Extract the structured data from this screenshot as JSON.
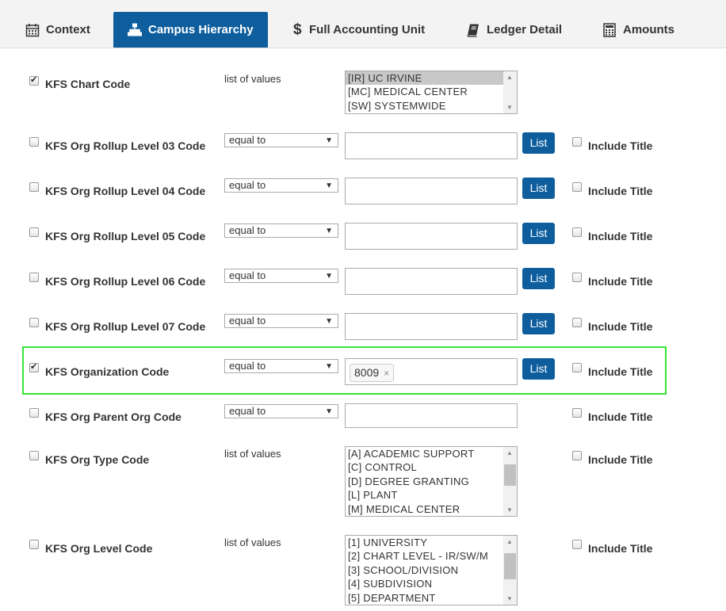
{
  "tabs": [
    {
      "label": "Context",
      "icon": "calendar-icon",
      "active": false
    },
    {
      "label": "Campus Hierarchy",
      "icon": "sitemap-icon",
      "active": true
    },
    {
      "label": "Full Accounting Unit",
      "icon": "dollar-icon",
      "active": false
    },
    {
      "label": "Ledger Detail",
      "icon": "book-icon",
      "active": false
    },
    {
      "label": "Amounts",
      "icon": "calculator-icon",
      "active": false
    }
  ],
  "colors": {
    "accent": "#0e5e9e",
    "highlight": "#33e533"
  },
  "list_button_label": "List",
  "include_title_label": "Include Title",
  "rows": {
    "chart": {
      "label": "KFS Chart Code",
      "checked": true,
      "operator": "list of values",
      "options": [
        "[IR] UC IRVINE",
        "[MC] MEDICAL CENTER",
        "[SW] SYSTEMWIDE"
      ],
      "selected": "[IR] UC IRVINE"
    },
    "rollup03": {
      "label": "KFS Org Rollup Level 03 Code",
      "checked": false,
      "operator": "equal to",
      "value": ""
    },
    "rollup04": {
      "label": "KFS Org Rollup Level 04 Code",
      "checked": false,
      "operator": "equal to",
      "value": ""
    },
    "rollup05": {
      "label": "KFS Org Rollup Level 05 Code",
      "checked": false,
      "operator": "equal to",
      "value": ""
    },
    "rollup06": {
      "label": "KFS Org Rollup Level 06 Code",
      "checked": false,
      "operator": "equal to",
      "value": ""
    },
    "rollup07": {
      "label": "KFS Org Rollup Level 07 Code",
      "checked": false,
      "operator": "equal to",
      "value": ""
    },
    "orgcode": {
      "label": "KFS Organization Code",
      "checked": true,
      "operator": "equal to",
      "chip": "8009",
      "chip_remove": "×"
    },
    "parent": {
      "label": "KFS Org Parent Org Code",
      "checked": false,
      "operator": "equal to",
      "value": ""
    },
    "type": {
      "label": "KFS Org Type Code",
      "checked": false,
      "operator": "list of values",
      "options": [
        "[A] ACADEMIC SUPPORT",
        "[C] CONTROL",
        "[D] DEGREE GRANTING",
        "[L] PLANT",
        "[M] MEDICAL CENTER"
      ]
    },
    "level": {
      "label": "KFS Org Level Code",
      "checked": false,
      "operator": "list of values",
      "options": [
        "[1] UNIVERSITY",
        "[2] CHART LEVEL - IR/SW/M",
        "[3] SCHOOL/DIVISION",
        "[4] SUBDIVISION",
        "[5] DEPARTMENT"
      ]
    }
  }
}
